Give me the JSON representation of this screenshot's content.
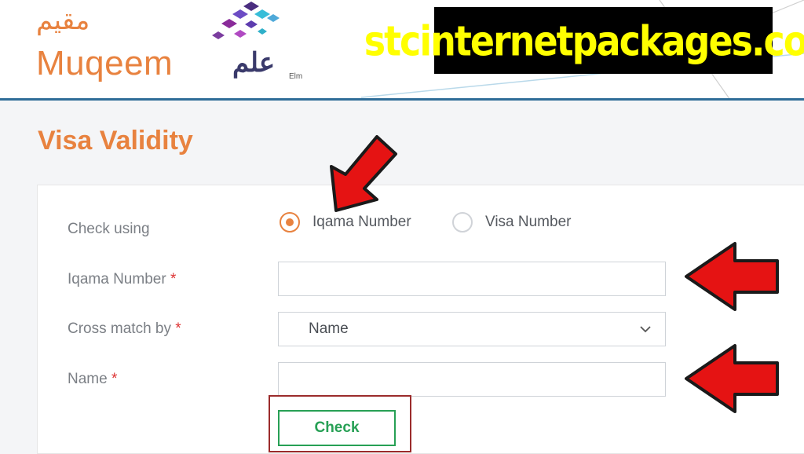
{
  "header": {
    "logo_arabic": "مقيم",
    "logo_english": "Muqeem",
    "elm_logo_arabic": "علم",
    "elm_logo_english": "Elm",
    "watermark": "stcinternetpackages.com"
  },
  "page": {
    "title": "Visa Validity"
  },
  "form": {
    "check_using_label": "Check using",
    "options": [
      {
        "label": "Iqama Number",
        "selected": true
      },
      {
        "label": "Visa Number",
        "selected": false
      }
    ],
    "iqama_label": "Iqama Number",
    "iqama_value": "",
    "cross_match_label": "Cross match by",
    "cross_match_value": "Name",
    "name_label": "Name",
    "name_value": "",
    "required_mark": "*",
    "check_button": "Check"
  },
  "colors": {
    "accent": "#e8823f",
    "header_rule": "#2f6d98",
    "button_green": "#27a055",
    "arrow_red": "#e51313",
    "watermark_text": "#ffff00"
  }
}
